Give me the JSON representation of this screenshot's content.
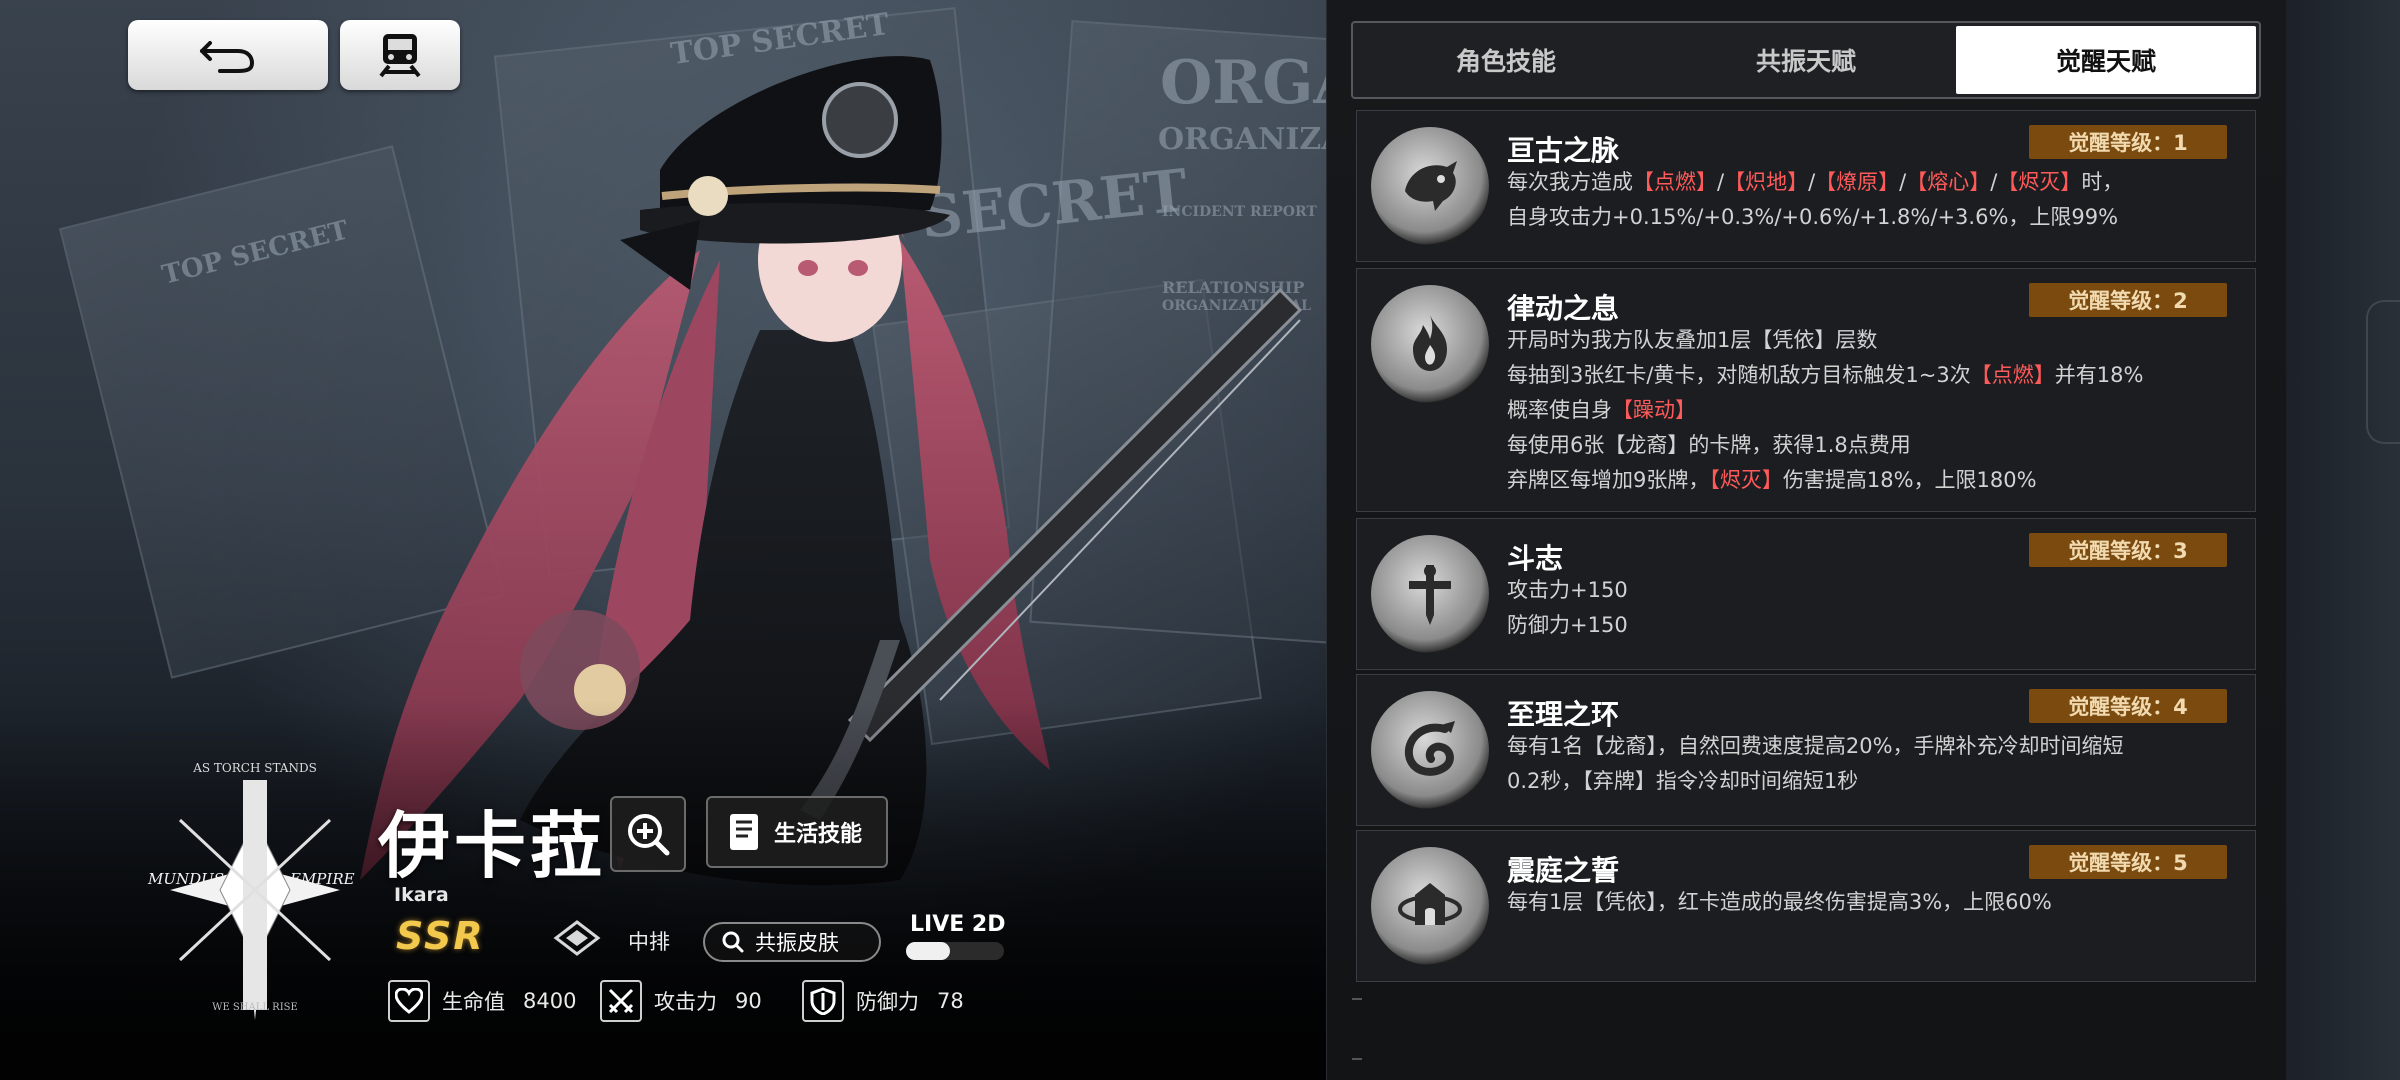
{
  "background": {
    "doc_texts": [
      "TOP SECRET",
      "ORGAN",
      "ORGANIZATIO",
      "SECRET",
      "TOP SECRET",
      "INCIDENT REPORT",
      "RELATIONSHIP",
      "ORGANIZATIONAL"
    ]
  },
  "emblem": {
    "top_text": "AS TORCH STANDS",
    "left_text": "MUNDUS",
    "right_text": "EMPIRE",
    "bottom_text": "WE SHALL RISE"
  },
  "character": {
    "name": "伊卡菈",
    "name_en": "Ikara",
    "rarity": "SSR",
    "position": "中排",
    "life_skill_label": "生活技能",
    "skin_label": "共振皮肤",
    "live2d_label": "LIVE 2D",
    "live2d_on": false,
    "stats": {
      "hp_label": "生命值",
      "hp_value": "8400",
      "atk_label": "攻击力",
      "atk_value": "90",
      "def_label": "防御力",
      "def_value": "78"
    }
  },
  "tabs": [
    {
      "label": "角色技能",
      "active": false
    },
    {
      "label": "共振天赋",
      "active": false
    },
    {
      "label": "觉醒天赋",
      "active": true
    }
  ],
  "talents": [
    {
      "name": "亘古之脉",
      "level": "觉醒等级：1",
      "icon": "dragon-head-icon",
      "lines": [
        [
          {
            "t": "每次我方造成",
            "h": false
          },
          {
            "t": "【点燃】",
            "h": true
          },
          {
            "t": "/",
            "h": false
          },
          {
            "t": "【炽地】",
            "h": true
          },
          {
            "t": "/",
            "h": false
          },
          {
            "t": "【燎原】",
            "h": true
          },
          {
            "t": "/",
            "h": false
          },
          {
            "t": "【熔心】",
            "h": true
          },
          {
            "t": "/",
            "h": false
          },
          {
            "t": "【烬灭】",
            "h": true
          },
          {
            "t": "时，",
            "h": false
          }
        ],
        [
          {
            "t": "自身攻击力+0.15%/+0.3%/+0.6%/+1.8%/+3.6%，上限99%",
            "h": false
          }
        ]
      ]
    },
    {
      "name": "律动之息",
      "level": "觉醒等级：2",
      "icon": "flame-icon",
      "lines": [
        [
          {
            "t": "开局时为我方队友叠加1层【凭依】层数",
            "h": false
          }
        ],
        [
          {
            "t": "每抽到3张红卡/黄卡，对随机敌方目标触发1~3次",
            "h": false
          },
          {
            "t": "【点燃】",
            "h": true
          },
          {
            "t": "并有18%",
            "h": false
          }
        ],
        [
          {
            "t": "概率使自身",
            "h": false
          },
          {
            "t": "【躁动】",
            "h": true
          }
        ],
        [
          {
            "t": "每使用6张【龙裔】的卡牌，获得1.8点费用",
            "h": false
          }
        ],
        [
          {
            "t": "弃牌区每增加9张牌，",
            "h": false
          },
          {
            "t": "【烬灭】",
            "h": true
          },
          {
            "t": "伤害提高18%，上限180%",
            "h": false
          }
        ]
      ]
    },
    {
      "name": "斗志",
      "level": "觉醒等级：3",
      "icon": "sword-icon",
      "lines": [
        [
          {
            "t": "攻击力+150",
            "h": false
          }
        ],
        [
          {
            "t": "防御力+150",
            "h": false
          }
        ]
      ]
    },
    {
      "name": "至理之环",
      "level": "觉醒等级：4",
      "icon": "dragon-coil-icon",
      "lines": [
        [
          {
            "t": "每有1名【龙裔】，自然回费速度提高20%，手牌补充冷却时间缩短",
            "h": false
          }
        ],
        [
          {
            "t": "0.2秒，【弃牌】指令冷却时间缩短1秒",
            "h": false
          }
        ]
      ]
    },
    {
      "name": "震庭之誓",
      "level": "觉醒等级：5",
      "icon": "castle-gate-icon",
      "lines": [
        [
          {
            "t": "每有1层【凭依】，红卡造成的最终伤害提高3%，上限60%",
            "h": false
          }
        ]
      ]
    }
  ],
  "colors": {
    "highlight": "#ff5a5a",
    "level_badge": "#7a4a0e",
    "rarity": "#f2c94c",
    "active_tab": "#ffffff"
  }
}
